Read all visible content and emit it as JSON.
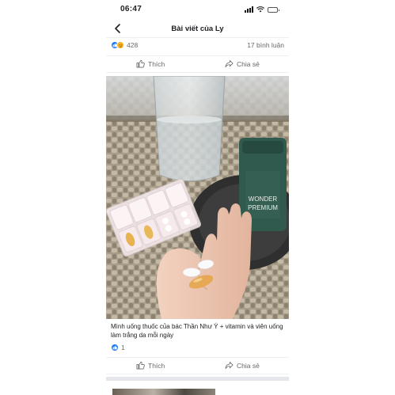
{
  "status_bar": {
    "time": "06:47"
  },
  "header": {
    "title": "Bài viết của Ly",
    "back_icon": "chevron-left-icon"
  },
  "stats": {
    "reaction_count": "428",
    "comments": "17 bình luận",
    "reactions": [
      "like",
      "sad"
    ]
  },
  "actions": {
    "like_label": "Thích",
    "share_label": "Chia sẻ"
  },
  "photo": {
    "product_label_line1": "WONDER",
    "product_label_line2": "PREMIUM"
  },
  "post": {
    "caption": "Mình uống thuốc của bác Thần Như Ý + vitamin và viên uống làm trắng da mỗi ngày",
    "like_count": "1"
  },
  "colors": {
    "accent": "#1877f2",
    "text_secondary": "#65676b"
  }
}
